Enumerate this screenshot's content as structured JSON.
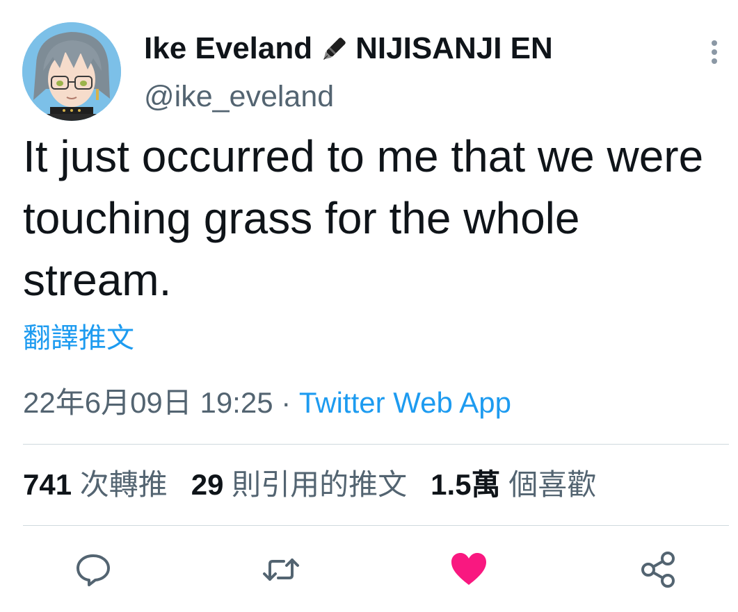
{
  "author": {
    "display_name": "Ike Eveland",
    "display_name_suffix": "NIJISANJI EN",
    "name_emoji_icon": "fountain-pen-icon",
    "handle": "@ike_eveland"
  },
  "tweet": {
    "text": "It just occurred to me that we were touching grass for the whole stream.",
    "translate_label": "翻譯推文",
    "date": "22年6月09日",
    "time": "19:25",
    "separator": "·",
    "source": "Twitter Web App"
  },
  "stats": {
    "retweets_count": "741",
    "retweets_label": "次轉推",
    "quotes_count": "29",
    "quotes_label": "則引用的推文",
    "likes_count": "1.5萬",
    "likes_label": "個喜歡"
  },
  "actions": [
    {
      "name": "reply",
      "icon": "reply-icon"
    },
    {
      "name": "retweet",
      "icon": "retweet-icon"
    },
    {
      "name": "like",
      "icon": "heart-icon",
      "active": true
    },
    {
      "name": "share",
      "icon": "share-icon"
    }
  ],
  "colors": {
    "link": "#1d9bf0",
    "secondary_text": "#536471",
    "like_active": "#f91880",
    "divider": "#cfd9de"
  }
}
